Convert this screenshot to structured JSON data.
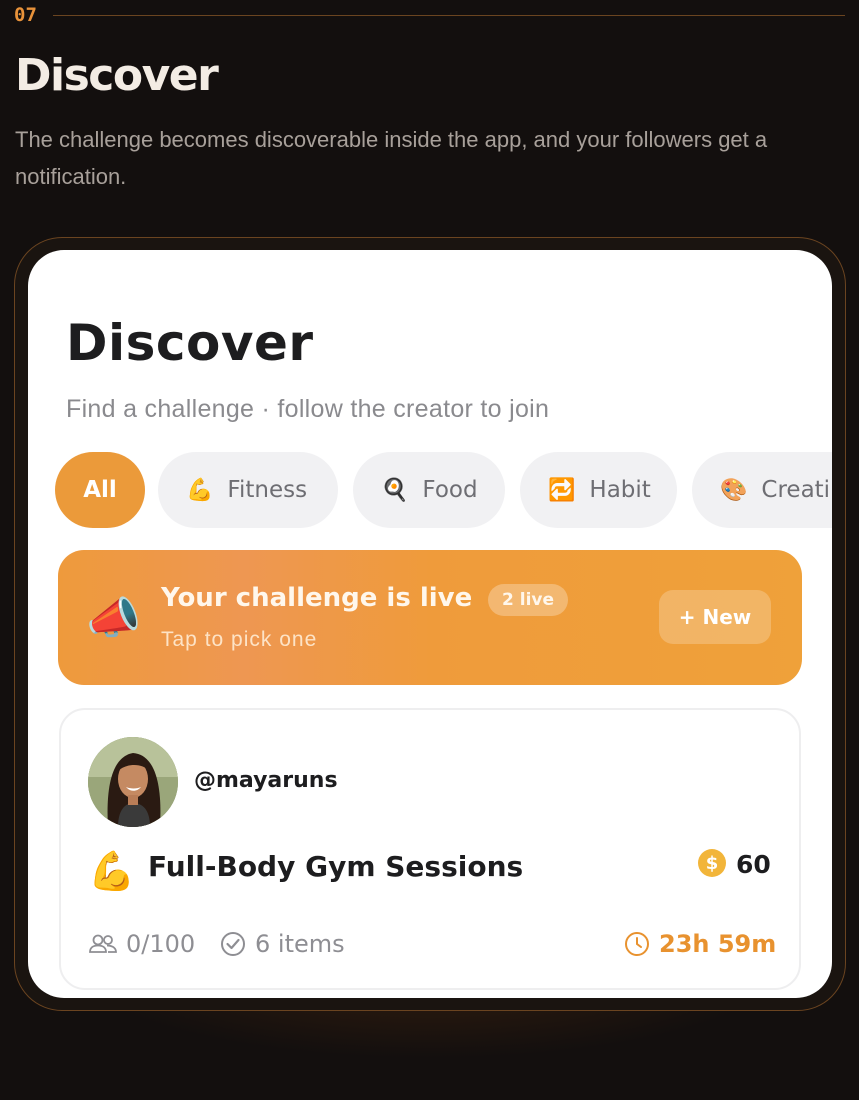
{
  "section": {
    "step": "07",
    "title": "Discover",
    "description": "The challenge becomes discoverable inside the app, and your followers get a notification."
  },
  "app": {
    "title": "Discover",
    "subtitle": "Find a challenge · follow the creator to join",
    "chips": [
      {
        "label": "All",
        "emoji": "",
        "active": true
      },
      {
        "label": "Fitness",
        "emoji": "💪",
        "active": false
      },
      {
        "label": "Food",
        "emoji": "🍳",
        "active": false
      },
      {
        "label": "Habit",
        "emoji": "🔁",
        "active": false
      },
      {
        "label": "Creati",
        "emoji": "🎨",
        "active": false
      }
    ],
    "banner": {
      "emoji": "📣",
      "title": "Your challenge is live",
      "badge": "2 live",
      "subtitle": "Tap to pick one",
      "button": "+ New"
    },
    "card": {
      "handle": "@mayaruns",
      "emoji": "💪",
      "title": "Full-Body Gym Sessions",
      "coin_symbol": "$",
      "reward": "60",
      "participants": "0/100",
      "items": "6 items",
      "time_left": "23h 59m"
    }
  },
  "colors": {
    "accent": "#eb9a3a",
    "background": "#130f0e",
    "timer": "#e8922f"
  }
}
